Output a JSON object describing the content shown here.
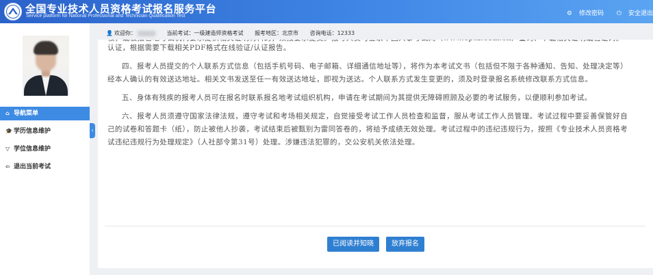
{
  "header": {
    "title": "全国专业技术人员资格考试报名服务平台",
    "subtitle": "Service platform for National Professional and Technician Qualification Test",
    "actions": [
      {
        "icon": "settings-icon",
        "label": "修改密码"
      },
      {
        "icon": "power-icon",
        "label": "安全退出"
      }
    ]
  },
  "infobar": {
    "welcome": "欢迎你：",
    "current_exam_label": "当前考试：",
    "current_exam": "一级建造师资格考试",
    "region_label": "报考地区：",
    "region": "北京市",
    "phone_label": "咨询电话：",
    "phone": "12333"
  },
  "sidebar": {
    "items": [
      {
        "icon": "home-icon",
        "label": "导航菜单",
        "active": true
      },
      {
        "icon": "graduation-icon",
        "label": "学历信息维护",
        "active": false
      },
      {
        "icon": "degree-icon",
        "label": "学位信息维护",
        "active": false
      },
      {
        "icon": "logout-icon",
        "label": "退出当前考试",
        "active": false
      }
    ],
    "collapse_glyph": "‹"
  },
  "notice": {
    "partial_top": "核，或被报名地考试机构要求提供相关证明材料的，须按要求提交。报考人员可登录中国人事考试网（www.cpta.com.cn）查询、下载相关证明或验证码。",
    "partial_top_2": "认证，根据需要下载相关PDF格式在线验证/认证报告。",
    "p4": "四、报考人员提交的个人联系方式信息（包括手机号码、电子邮箱、详细通信地址等），将作为本考试文书（包括但不限于各种通知、告知、处理决定等）经本人确认的有效送达地址。相关文书发送至任一有效送达地址，即视为送达。个人联系方式发生变更的，须及时登录报名系统修改联系方式信息。",
    "p5": "五、身体有残疾的报考人员可在报名时联系报名地考试组织机构，申请在考试期间为其提供无障碍照顾及必要的考试服务，以便顺利参加考试。",
    "p6": "六、报考人员须遵守国家法律法规，遵守考试和考场相关规定，自觉接受考试工作人员检查和监督，服从考试工作人员管理。考试过程中要妥善保管好自己的试卷和答题卡（纸），防止被他人抄袭，考试结束后被甄别为雷同答卷的，将给予成绩无效处理。考试过程中的违纪违规行为，按照《专业技术人员资格考试违纪违规行为处理规定》（人社部令第31号）处理。涉嫌违法犯罪的，交公安机关依法处理。"
  },
  "buttons": {
    "read": "已阅读并知晓",
    "quit": "放弃报名"
  }
}
